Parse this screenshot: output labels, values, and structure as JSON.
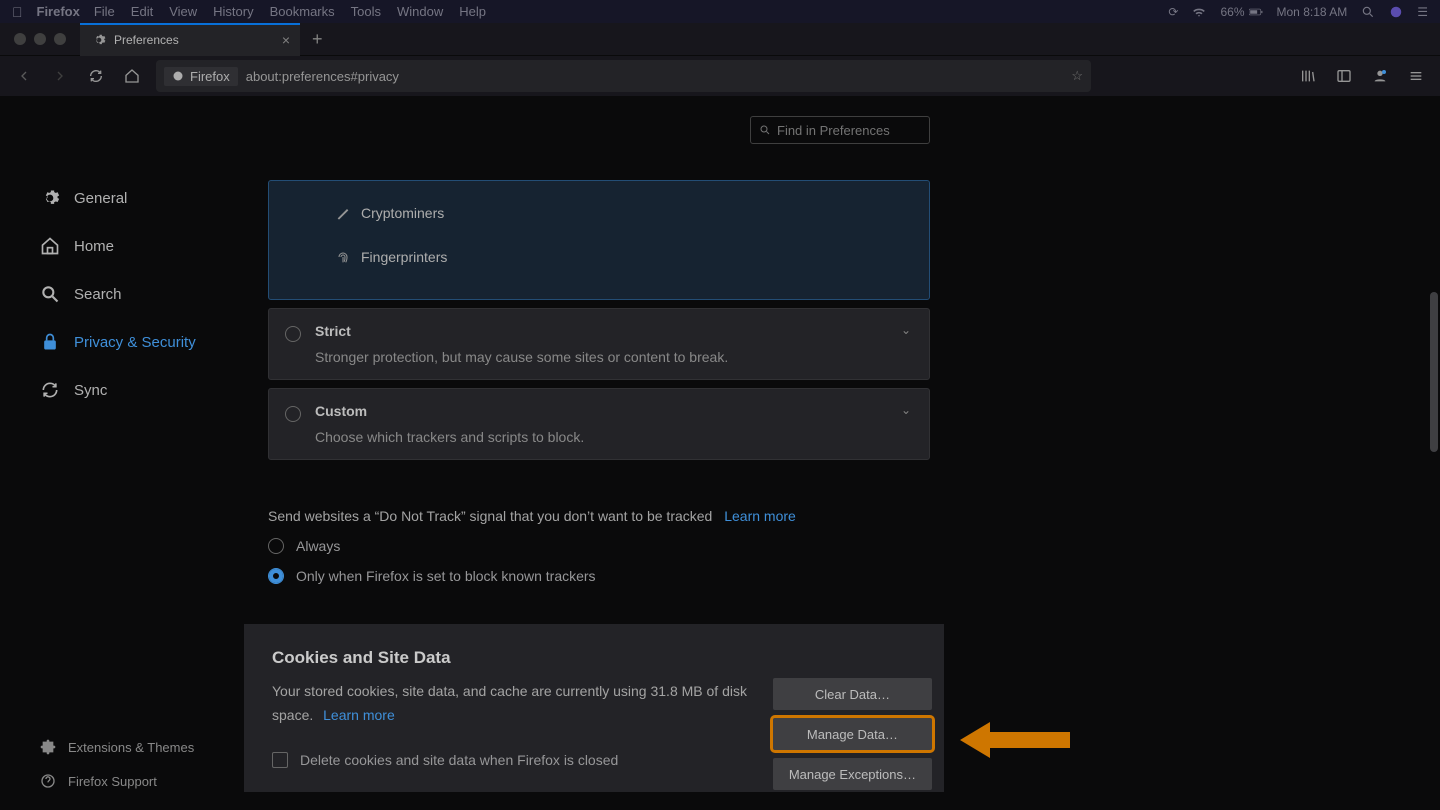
{
  "menubar": {
    "app": "Firefox",
    "items": [
      "File",
      "Edit",
      "View",
      "History",
      "Bookmarks",
      "Tools",
      "Window",
      "Help"
    ],
    "battery": "66%",
    "clock": "Mon 8:18 AM"
  },
  "tab": {
    "title": "Preferences"
  },
  "addressbar": {
    "identity": "Firefox",
    "url": "about:preferences#privacy"
  },
  "search": {
    "placeholder": "Find in Preferences"
  },
  "sidebar": {
    "items": [
      {
        "label": "General"
      },
      {
        "label": "Home"
      },
      {
        "label": "Search"
      },
      {
        "label": "Privacy & Security"
      },
      {
        "label": "Sync"
      }
    ],
    "footer": [
      {
        "label": "Extensions & Themes"
      },
      {
        "label": "Firefox Support"
      }
    ]
  },
  "protection": {
    "active_items": [
      "Cryptominers",
      "Fingerprinters"
    ],
    "options": [
      {
        "title": "Strict",
        "desc": "Stronger protection, but may cause some sites or content to break."
      },
      {
        "title": "Custom",
        "desc": "Choose which trackers and scripts to block."
      }
    ]
  },
  "dnt": {
    "text": "Send websites a “Do Not Track” signal that you don’t want to be tracked",
    "link": "Learn more",
    "opts": [
      "Always",
      "Only when Firefox is set to block known trackers"
    ]
  },
  "cookies": {
    "heading": "Cookies and Site Data",
    "desc": "Your stored cookies, site data, and cache are currently using 31.8 MB of disk space.",
    "learn_more": "Learn more",
    "checkbox": "Delete cookies and site data when Firefox is closed",
    "buttons": {
      "clear": "Clear Data…",
      "manage": "Manage Data…",
      "exceptions": "Manage Exceptions…"
    }
  }
}
